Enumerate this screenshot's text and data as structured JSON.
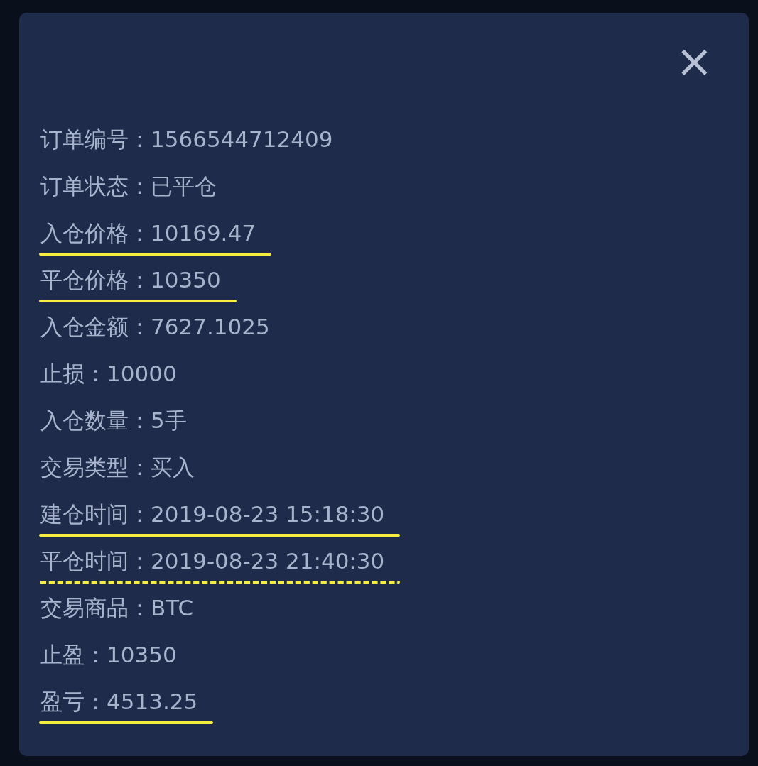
{
  "dialog": {
    "close": "×",
    "fields": [
      {
        "kind": "plain",
        "label": "订单编号：",
        "value": "1566544712409"
      },
      {
        "kind": "plain",
        "label": "订单状态：",
        "value": "已平仓"
      },
      {
        "kind": "underlined",
        "label": "入仓价格：",
        "value": "10169.47"
      },
      {
        "kind": "underlined",
        "label": "平仓价格：",
        "value": "10350"
      },
      {
        "kind": "plain",
        "label": "入仓金额：",
        "value": "7627.1025"
      },
      {
        "kind": "plain",
        "label": "止损：",
        "value": "10000"
      },
      {
        "kind": "plain",
        "label": "入仓数量：",
        "value": "5手"
      },
      {
        "kind": "plain",
        "label": "交易类型：",
        "value": "买入"
      },
      {
        "kind": "underlined",
        "label": "建仓时间：",
        "value": "2019-08-23 15:18:30"
      },
      {
        "kind": "dashed",
        "label": "平仓时间：",
        "value": "2019-08-23 21:40:30"
      },
      {
        "kind": "plain",
        "label": "交易商品：",
        "value": "BTC"
      },
      {
        "kind": "plain",
        "label": "止盈：",
        "value": "10350"
      },
      {
        "kind": "underlined",
        "label": "盈亏：",
        "value": "4513.25"
      }
    ]
  }
}
